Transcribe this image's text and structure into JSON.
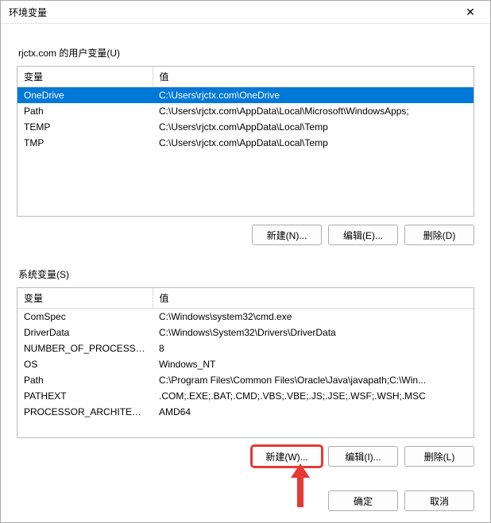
{
  "titlebar": {
    "title": "环境变量"
  },
  "user_section": {
    "label": "rjctx.com 的用户变量(U)",
    "columns": {
      "var": "变量",
      "val": "值"
    },
    "rows": [
      {
        "var": "OneDrive",
        "val": "C:\\Users\\rjctx.com\\OneDrive",
        "selected": true
      },
      {
        "var": "Path",
        "val": "C:\\Users\\rjctx.com\\AppData\\Local\\Microsoft\\WindowsApps;"
      },
      {
        "var": "TEMP",
        "val": "C:\\Users\\rjctx.com\\AppData\\Local\\Temp"
      },
      {
        "var": "TMP",
        "val": "C:\\Users\\rjctx.com\\AppData\\Local\\Temp"
      }
    ],
    "buttons": {
      "new": "新建(N)...",
      "edit": "编辑(E)...",
      "del": "删除(D)"
    }
  },
  "system_section": {
    "label": "系统变量(S)",
    "columns": {
      "var": "变量",
      "val": "值"
    },
    "rows": [
      {
        "var": "ComSpec",
        "val": "C:\\Windows\\system32\\cmd.exe"
      },
      {
        "var": "DriverData",
        "val": "C:\\Windows\\System32\\Drivers\\DriverData"
      },
      {
        "var": "NUMBER_OF_PROCESSORS",
        "val": "8"
      },
      {
        "var": "OS",
        "val": "Windows_NT"
      },
      {
        "var": "Path",
        "val": "C:\\Program Files\\Common Files\\Oracle\\Java\\javapath;C:\\Win..."
      },
      {
        "var": "PATHEXT",
        "val": ".COM;.EXE;.BAT;.CMD;.VBS;.VBE;.JS;.JSE;.WSF;.WSH;.MSC"
      },
      {
        "var": "PROCESSOR_ARCHITECT...",
        "val": "AMD64"
      }
    ],
    "buttons": {
      "new": "新建(W)...",
      "edit": "编辑(I)...",
      "del": "删除(L)"
    }
  },
  "footer": {
    "ok": "确定",
    "cancel": "取消"
  }
}
